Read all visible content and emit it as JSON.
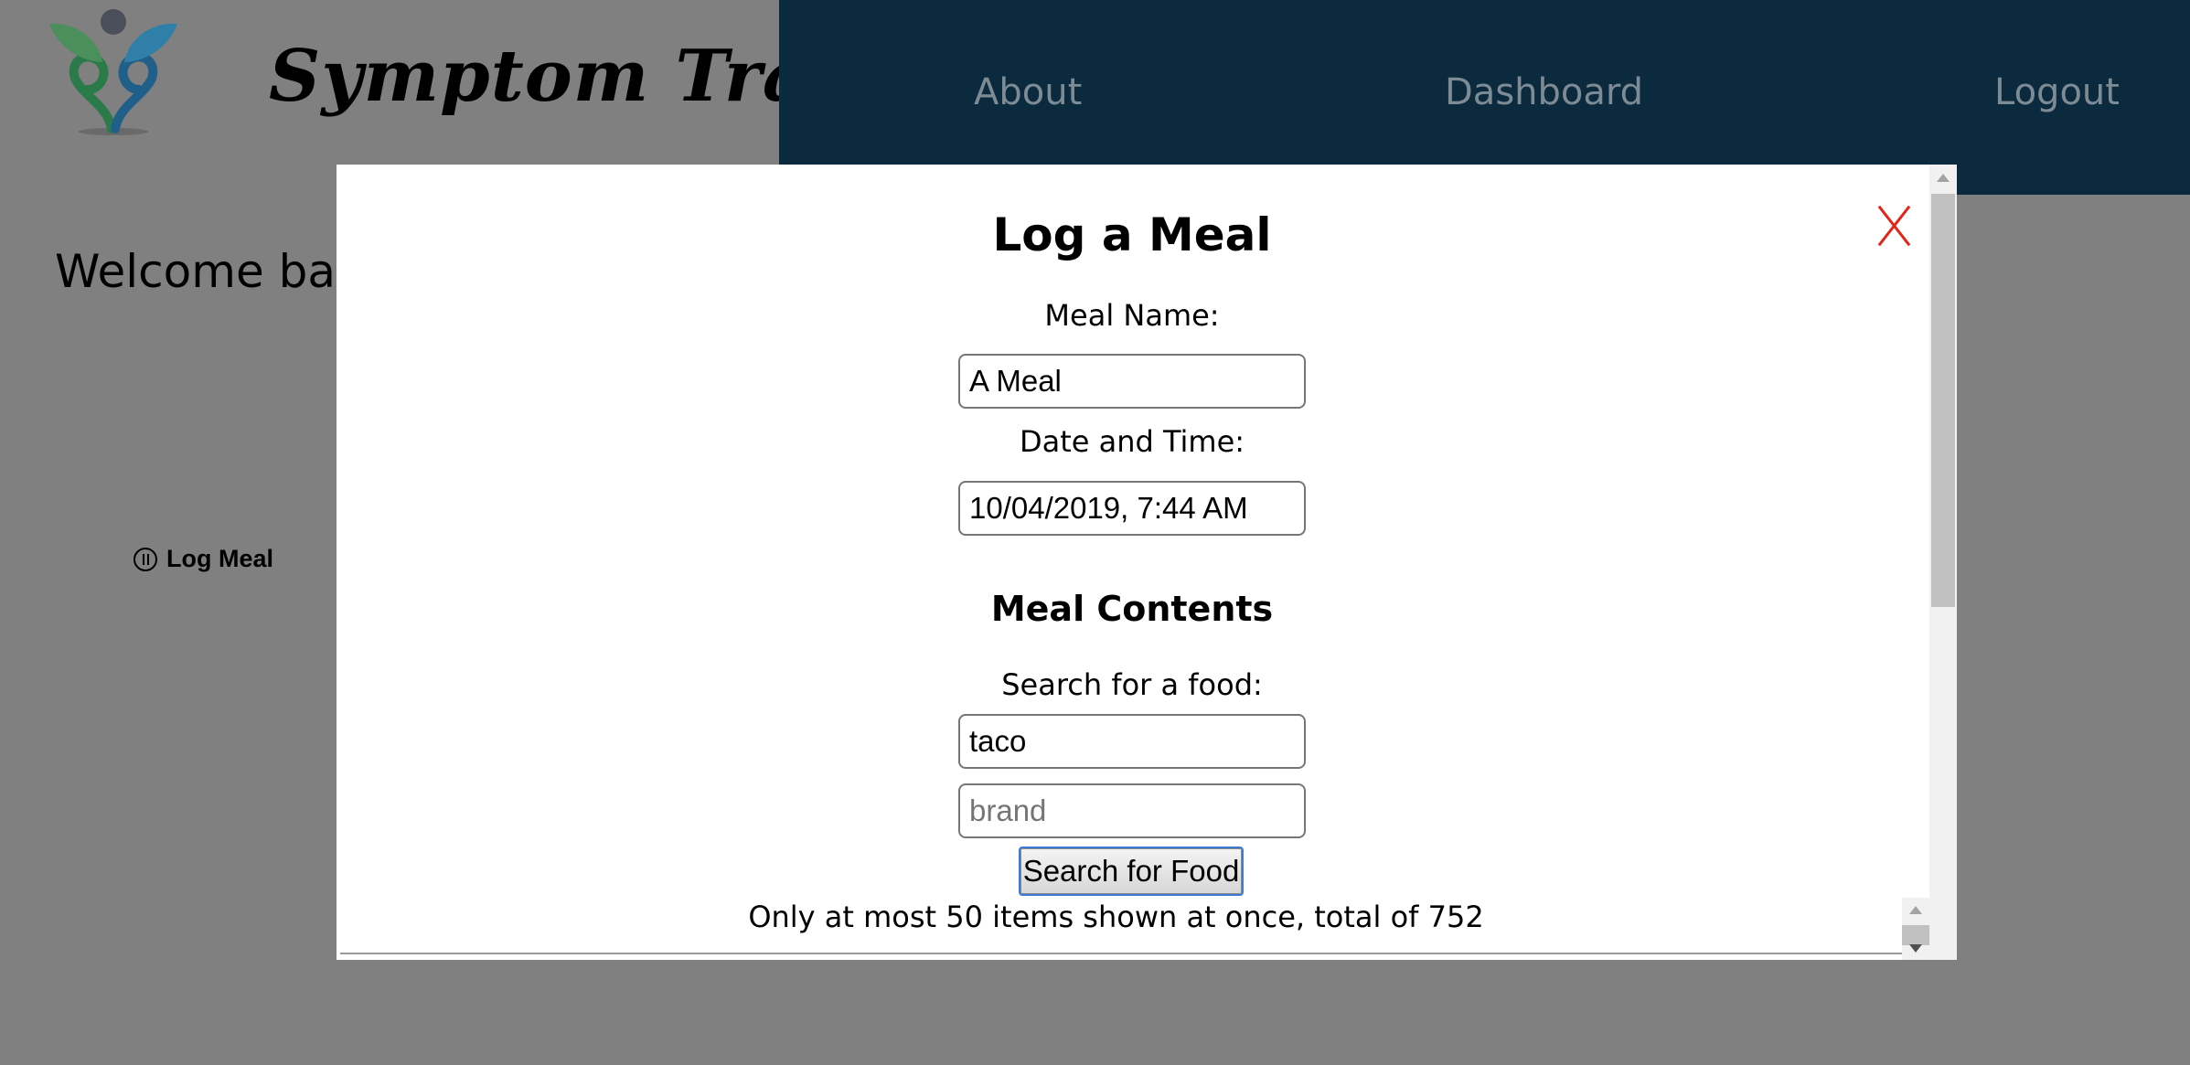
{
  "header": {
    "brand": "Symptom Tracker",
    "nav": [
      "About",
      "Dashboard",
      "Logout"
    ]
  },
  "page": {
    "welcome": "Welcome back",
    "log_meal_link": "Log Meal"
  },
  "modal": {
    "title": "Log a Meal",
    "meal_name_label": "Meal Name:",
    "meal_name_value": "A Meal",
    "datetime_label": "Date and Time:",
    "datetime_value": "10/04/2019, 7:44 AM",
    "contents_title": "Meal Contents",
    "search_label": "Search for a food:",
    "food_value": "taco",
    "brand_placeholder": "brand",
    "search_button": "Search for Food",
    "results_info": "Only at most 50 items shown at once, total of 752"
  },
  "colors": {
    "navbar": "#0c2a3d",
    "close_icon": "#e0261a",
    "overlay": "#808080"
  }
}
